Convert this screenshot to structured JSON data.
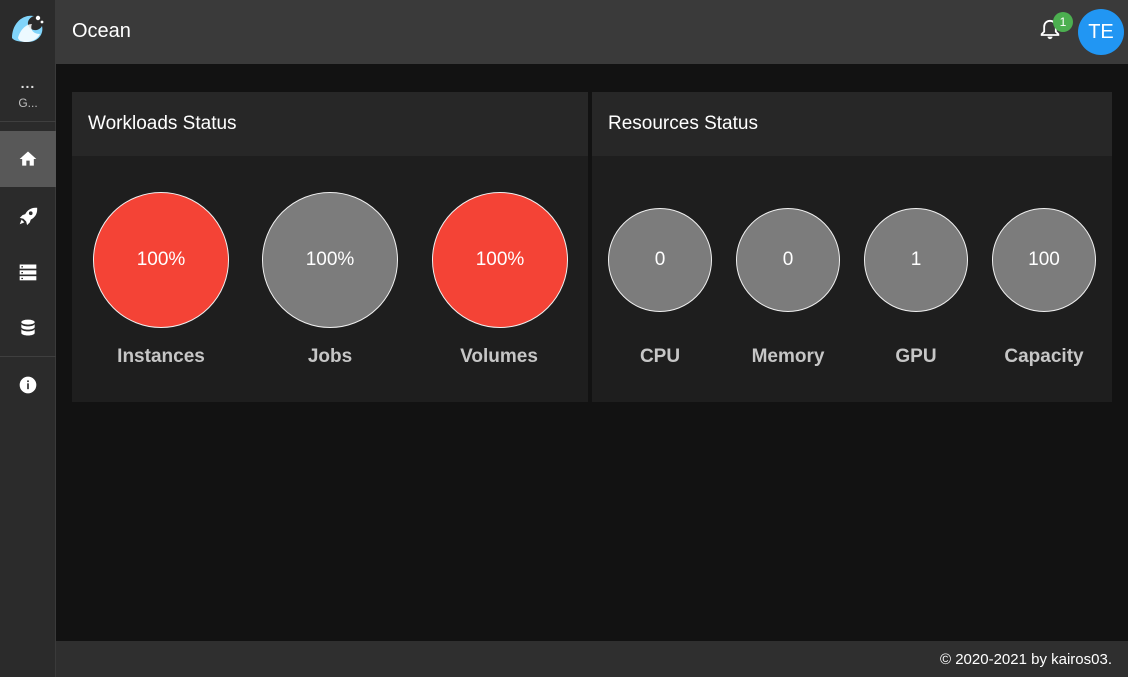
{
  "app": {
    "title": "Ocean",
    "brand_color": "#2196f3"
  },
  "sidebar": {
    "workspace": {
      "dots": "...",
      "name": "G..."
    },
    "items": [
      {
        "icon": "home-icon",
        "active": true
      },
      {
        "icon": "rocket-icon",
        "active": false
      },
      {
        "icon": "server-icon",
        "active": false
      },
      {
        "icon": "database-icon",
        "active": false
      },
      {
        "icon": "info-icon",
        "active": false
      }
    ]
  },
  "header": {
    "notifications_count": "1",
    "avatar_initials": "TE"
  },
  "workloads": {
    "title": "Workloads Status",
    "items": [
      {
        "label": "Instances",
        "value": "100%",
        "color": "#f44336"
      },
      {
        "label": "Jobs",
        "value": "100%",
        "color": "#7c7c7c"
      },
      {
        "label": "Volumes",
        "value": "100%",
        "color": "#f44336"
      }
    ]
  },
  "resources": {
    "title": "Resources Status",
    "items": [
      {
        "label": "CPU",
        "value": "0",
        "color": "#7c7c7c"
      },
      {
        "label": "Memory",
        "value": "0",
        "color": "#7c7c7c"
      },
      {
        "label": "GPU",
        "value": "1",
        "color": "#7c7c7c"
      },
      {
        "label": "Capacity",
        "value": "100",
        "color": "#7c7c7c"
      }
    ]
  },
  "footer": {
    "copyright": "© 2020-2021 by kairos03."
  }
}
